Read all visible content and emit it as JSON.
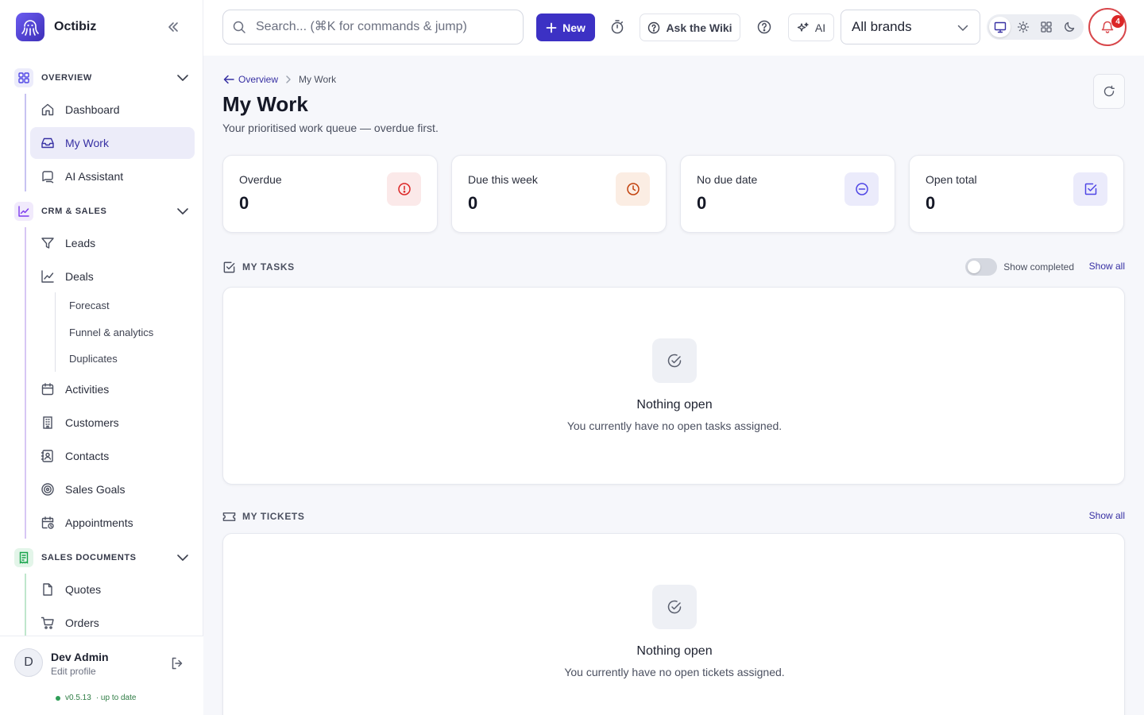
{
  "app": {
    "name": "Octibiz"
  },
  "sidebar": {
    "sections": [
      {
        "label": "OVERVIEW",
        "color": "#4f46e5"
      },
      {
        "label": "CRM & SALES",
        "color": "#7c3aed"
      },
      {
        "label": "SALES DOCUMENTS",
        "color": "#16a34a"
      }
    ],
    "overview_items": [
      {
        "label": "Dashboard",
        "icon": "home-icon"
      },
      {
        "label": "My Work",
        "icon": "inbox-icon"
      },
      {
        "label": "AI Assistant",
        "icon": "chat-icon"
      }
    ],
    "crm_items": [
      {
        "label": "Leads",
        "icon": "funnel-icon"
      },
      {
        "label": "Deals",
        "icon": "trend-icon"
      }
    ],
    "deal_subitems": [
      "Forecast",
      "Funnel & analytics",
      "Duplicates"
    ],
    "crm_items_more": [
      {
        "label": "Activities",
        "icon": "calendar-icon"
      },
      {
        "label": "Customers",
        "icon": "building-icon"
      },
      {
        "label": "Contacts",
        "icon": "contact-icon"
      },
      {
        "label": "Sales Goals",
        "icon": "target-icon"
      },
      {
        "label": "Appointments",
        "icon": "calendar-clock-icon"
      }
    ],
    "docs_items": [
      {
        "label": "Quotes",
        "icon": "file-icon"
      },
      {
        "label": "Orders",
        "icon": "cart-icon"
      }
    ],
    "active_item": "My Work"
  },
  "user": {
    "initial": "D",
    "name": "Dev Admin",
    "sub": "Edit profile",
    "version": "v0.5.13",
    "version_status": "· up to date"
  },
  "topbar": {
    "search_placeholder": "Search... (⌘K for commands & jump)",
    "new_label": "New",
    "wiki_label": "Ask the Wiki",
    "ai_label": "AI",
    "brand_select": "All brands",
    "notification_count": "4"
  },
  "page": {
    "breadcrumb_parent": "Overview",
    "breadcrumb_current": "My Work",
    "title": "My Work",
    "subtitle": "Your prioritised work queue — overdue first."
  },
  "stats": [
    {
      "label": "Overdue",
      "value": "0",
      "icon": "alert-circle-icon",
      "color": "#dc2626",
      "bg": "#fbe9e9"
    },
    {
      "label": "Due this week",
      "value": "0",
      "icon": "clock-icon",
      "color": "#c2410c",
      "bg": "#fbede3"
    },
    {
      "label": "No due date",
      "value": "0",
      "icon": "minus-circle-icon",
      "color": "#4f46e5",
      "bg": "#ebebfb"
    },
    {
      "label": "Open total",
      "value": "0",
      "icon": "check-square-icon",
      "color": "#4f46e5",
      "bg": "#ebebfb"
    }
  ],
  "tasks": {
    "title": "MY TASKS",
    "toggle_label": "Show completed",
    "show_all": "Show all",
    "empty_title": "Nothing open",
    "empty_sub": "You currently have no open tasks assigned."
  },
  "tickets": {
    "title": "MY TICKETS",
    "show_all": "Show all",
    "empty_title": "Nothing open",
    "empty_sub": "You currently have no open tickets assigned."
  }
}
